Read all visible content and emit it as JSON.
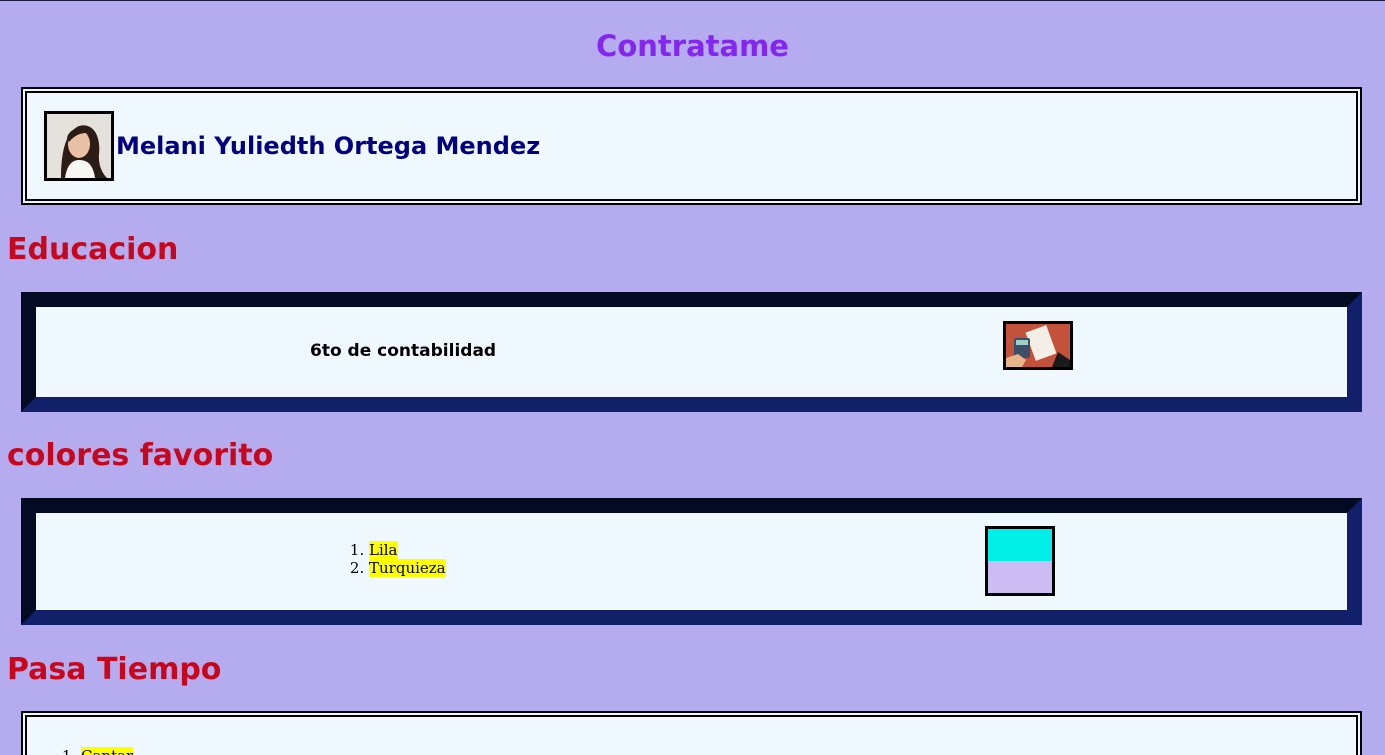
{
  "page": {
    "title": "Contratame",
    "background_color": "#b4acee",
    "title_color": "#8426f0",
    "heading_color": "#c8071c"
  },
  "profile": {
    "name": "Melani Yuliedth Ortega Mendez",
    "avatar_icon": "profile-photo",
    "name_color": "#000080"
  },
  "education": {
    "heading": "Educacion",
    "item": "6to de contabilidad",
    "image_icon": "accounting-calculator-receipt"
  },
  "colors": {
    "heading": "colores favorito",
    "items": [
      "Lila",
      "Turquieza"
    ],
    "swatch": {
      "top": "#00f0e8",
      "bottom": "#cbbcf4"
    }
  },
  "hobbies": {
    "heading": "Pasa Tiempo",
    "items": [
      "Cantar"
    ]
  },
  "highlight_color": "#ffff00"
}
